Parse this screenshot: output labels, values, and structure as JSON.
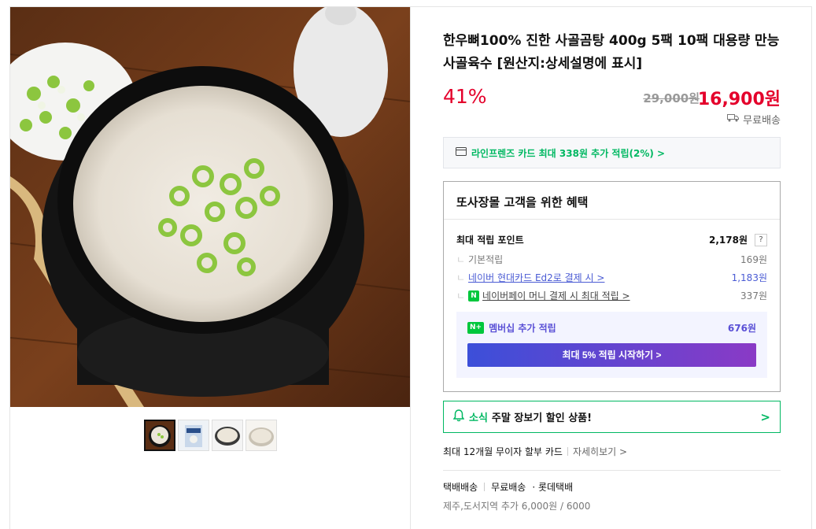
{
  "product": {
    "title": "한우뼈100% 진한 사골곰탕 400g 5팩 10팩 대용량 만능 사골육수 [원산지:상세설명에 표시]",
    "discount": "41%",
    "original_price": "29,000원",
    "sale_price": "16,900원",
    "shipping": "무료배송"
  },
  "card_promo": "라인프렌즈 카드 최대 338원 추가 적립(2%) >",
  "benefits": {
    "heading": "또사장몰 고객을 위한 혜택",
    "max_points_label": "최대 적립 포인트",
    "max_points_value": "2,178원",
    "help": "?",
    "rows": [
      {
        "label": "기본적립",
        "value": "169원"
      },
      {
        "label": "네이버 현대카드 Ed2로 결제 시 >",
        "value": "1,183원"
      },
      {
        "label": "네이버페이 머니 결제 시 최대 적립 >",
        "value": "337원"
      }
    ],
    "npay_badge": "N",
    "membership_badge": "N+",
    "membership_label": "멤버십 추가 적립",
    "membership_value": "676원",
    "membership_button": "최대 5% 적립 시작하기 >"
  },
  "alert": {
    "tag": "소식",
    "text": "주말 장보기 할인 상품!",
    "chevron": ">"
  },
  "installment": {
    "label": "최대 12개월 무이자 할부 카드",
    "more": "자세히보기 >"
  },
  "delivery": {
    "method": "택배배송",
    "fee": "무료배송",
    "carrier": "· 롯데택배",
    "extra": "제주,도서지역 추가 6,000원 / 6000"
  },
  "colors": {
    "price_red": "#e4002b",
    "naver_green": "#00b862",
    "point_blue": "#4a5bd4"
  }
}
